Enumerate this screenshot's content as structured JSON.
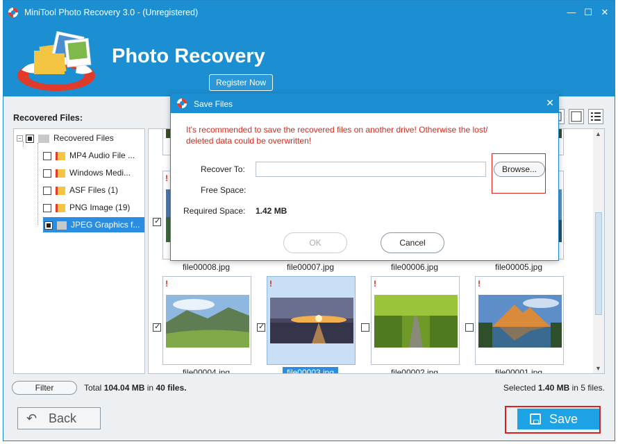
{
  "titlebar": {
    "title": "MiniTool Photo Recovery 3.0 - (Unregistered)",
    "minimize": "—",
    "maximize": "☐",
    "close": "✕"
  },
  "banner": {
    "title": "Photo Recovery",
    "register_label": "Register Now"
  },
  "left_panel": {
    "label": "Recovered Files:",
    "root": {
      "label": "Recovered Files",
      "state": "partial"
    },
    "items": [
      {
        "label": "MP4 Audio File ...",
        "checked": false
      },
      {
        "label": "Windows Medi...",
        "checked": false
      },
      {
        "label": "ASF Files (1)",
        "checked": false
      },
      {
        "label": "PNG Image (19)",
        "checked": false
      },
      {
        "label": "JPEG Graphics f...",
        "checked": "partial",
        "selected": true
      }
    ]
  },
  "grid": {
    "row1": [
      {
        "name": "file00008.jpg",
        "checked": true
      },
      {
        "name": "file00007.jpg",
        "checked": false
      },
      {
        "name": "file00006.jpg",
        "checked": false
      },
      {
        "name": "file00005.jpg",
        "checked": false
      }
    ],
    "row2": [
      {
        "name": "file00004.jpg",
        "checked": true,
        "warn": "!"
      },
      {
        "name": "file00003.jpg",
        "checked": true,
        "warn": "!",
        "selected": true
      },
      {
        "name": "file00002.jpg",
        "checked": false,
        "warn": "!"
      },
      {
        "name": "file00001.jpg",
        "checked": false,
        "warn": "!"
      }
    ],
    "warn_symbol": "!"
  },
  "status": {
    "filter_label": "Filter",
    "total_prefix": "Total",
    "total_size": "104.04 MB",
    "total_mid": "in",
    "total_count": "40 files.",
    "selected_prefix": "Selected",
    "selected_size": "1.40 MB",
    "selected_mid": "in",
    "selected_count": "5 files."
  },
  "footer": {
    "back_label": "Back",
    "save_label": "Save"
  },
  "dialog": {
    "title": "Save Files",
    "close": "✕",
    "warning_line1": "It's recommended to save the recovered files on another drive! Otherwise the lost/",
    "warning_line2": "deleted data could be overwritten!",
    "recover_to_label": "Recover To:",
    "recover_to_value": "",
    "browse_label": "Browse...",
    "free_space_label": "Free Space:",
    "required_space_label": "Required Space:",
    "required_space_value": "1.42 MB",
    "ok_label": "OK",
    "cancel_label": "Cancel"
  },
  "colors": {
    "brand_blue": "#1b8fd2",
    "save_blue": "#1ea2e6",
    "highlight_red": "#e02020",
    "warning_red": "#d42a1c",
    "selection_blue": "#2a8de0"
  }
}
